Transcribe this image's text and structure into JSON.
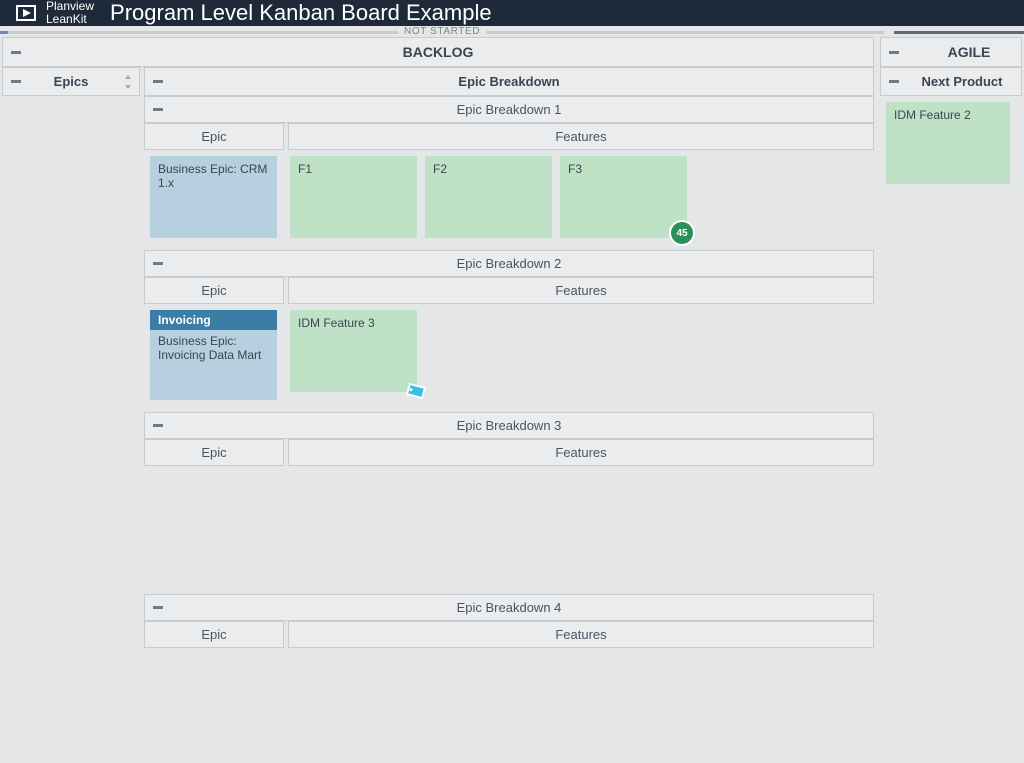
{
  "app": {
    "brand_line1": "Planview",
    "brand_line2": "LeanKit",
    "board_title": "Program Level Kanban Board Example"
  },
  "status": {
    "not_started": "NOT STARTED"
  },
  "lanes": {
    "backlog": {
      "title": "BACKLOG"
    },
    "agile": {
      "title": "AGILE"
    }
  },
  "columns": {
    "epics": {
      "title": "Epics"
    },
    "epic_breakdown": {
      "title": "Epic Breakdown"
    },
    "next_product": {
      "title": "Next Product"
    }
  },
  "sub_labels": {
    "epic": "Epic",
    "features": "Features"
  },
  "sections": {
    "eb1": {
      "title": "Epic Breakdown 1"
    },
    "eb2": {
      "title": "Epic Breakdown 2"
    },
    "eb3": {
      "title": "Epic Breakdown 3"
    },
    "eb4": {
      "title": "Epic Breakdown 4"
    }
  },
  "cards": {
    "eb1_epic": {
      "title": "Business Epic: CRM 1.x"
    },
    "eb1_f1": {
      "title": "F1"
    },
    "eb1_f2": {
      "title": "F2"
    },
    "eb1_f3": {
      "title": "F3",
      "badge": "45"
    },
    "eb2_epic": {
      "tag": "Invoicing",
      "title": "Business Epic: Invoicing Data Mart"
    },
    "eb2_f1": {
      "title": "IDM Feature 3"
    },
    "agile_next": {
      "title": "IDM Feature 2"
    }
  },
  "colors": {
    "card_green": "#bfe2c7",
    "card_blue": "#b6d0e0",
    "badge_green": "#2f8f5b",
    "badge_cyan": "#3bbee8"
  }
}
